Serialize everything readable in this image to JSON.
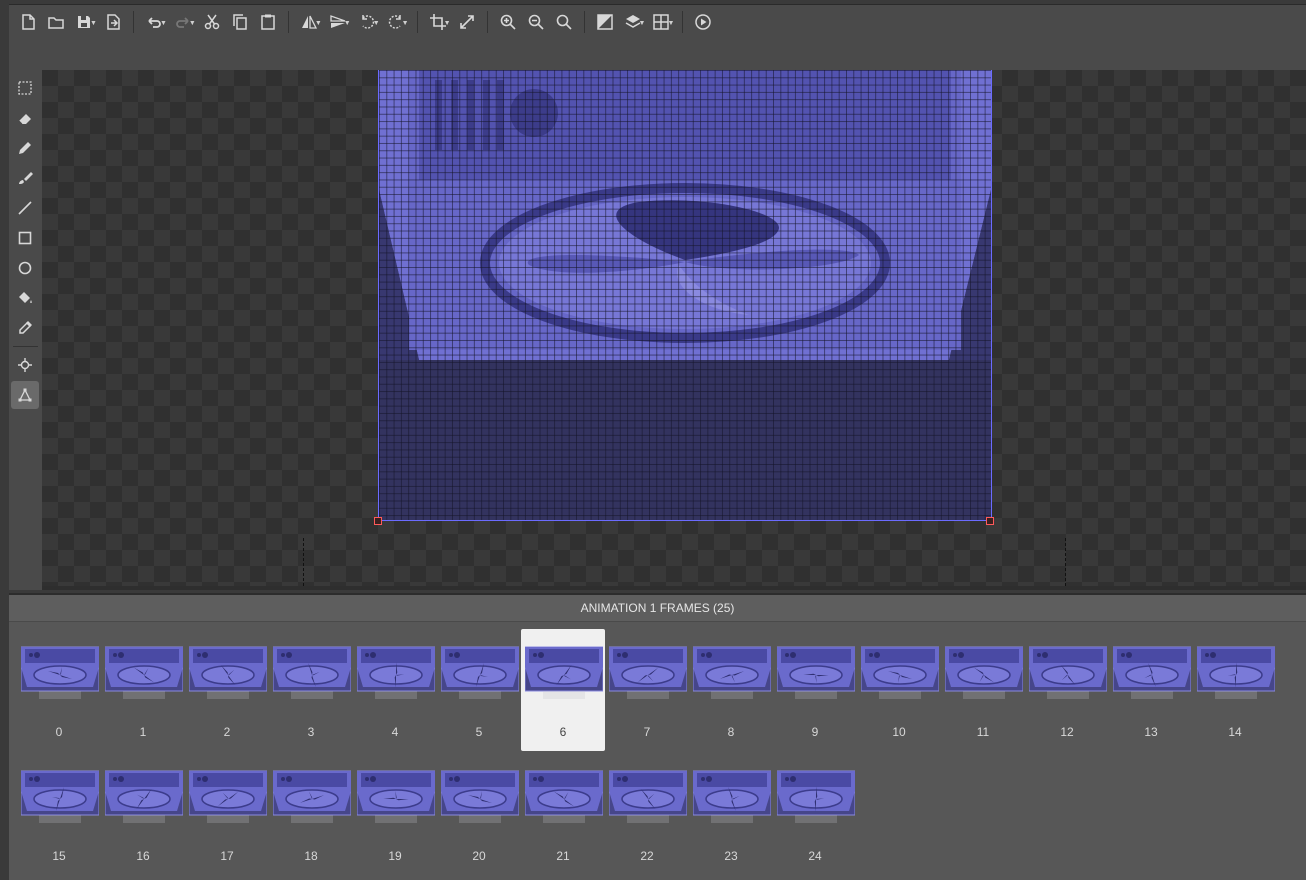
{
  "toolbar": {
    "items": [
      {
        "id": "new-file",
        "icon": "new-file-icon"
      },
      {
        "id": "open-folder",
        "icon": "folder-icon"
      },
      {
        "id": "save",
        "icon": "save-icon",
        "dropdown": true
      },
      {
        "id": "export",
        "icon": "export-icon"
      },
      {
        "id": "undo",
        "icon": "undo-icon",
        "dropdown": true
      },
      {
        "id": "redo",
        "icon": "redo-icon",
        "dropdown": true,
        "disabled": true
      },
      {
        "id": "cut",
        "icon": "scissors-icon"
      },
      {
        "id": "copy",
        "icon": "copy-icon"
      },
      {
        "id": "paste",
        "icon": "paste-icon"
      },
      {
        "id": "flip-horizontal",
        "icon": "flip-horizontal-icon",
        "dropdown": true
      },
      {
        "id": "flip-vertical",
        "icon": "flip-vertical-icon",
        "dropdown": true
      },
      {
        "id": "rotate-left",
        "icon": "rotate-left-icon",
        "dropdown": true
      },
      {
        "id": "rotate-right",
        "icon": "rotate-right-icon",
        "dropdown": true
      },
      {
        "id": "crop",
        "icon": "crop-icon",
        "dropdown": true
      },
      {
        "id": "resize",
        "icon": "resize-icon"
      },
      {
        "id": "zoom-in",
        "icon": "zoom-in-icon"
      },
      {
        "id": "zoom-out",
        "icon": "zoom-out-icon"
      },
      {
        "id": "zoom-fit",
        "icon": "zoom-icon"
      },
      {
        "id": "background",
        "icon": "background-toggle-icon"
      },
      {
        "id": "layers",
        "icon": "layers-icon",
        "dropdown": true
      },
      {
        "id": "grid",
        "icon": "grid-icon",
        "dropdown": true
      },
      {
        "id": "play",
        "icon": "play-icon"
      }
    ]
  },
  "tools": [
    {
      "id": "marquee",
      "icon": "marquee-select-icon"
    },
    {
      "id": "eraser",
      "icon": "eraser-icon"
    },
    {
      "id": "pencil",
      "icon": "pencil-icon"
    },
    {
      "id": "brush",
      "icon": "brush-icon"
    },
    {
      "id": "line",
      "icon": "line-icon"
    },
    {
      "id": "rectangle",
      "icon": "rectangle-icon"
    },
    {
      "id": "ellipse",
      "icon": "ellipse-icon"
    },
    {
      "id": "fill",
      "icon": "paint-bucket-icon"
    },
    {
      "id": "eyedropper",
      "icon": "eyedropper-icon"
    },
    {
      "id": "origin",
      "icon": "crosshair-icon"
    },
    {
      "id": "transform",
      "icon": "transform-nodes-icon",
      "active": true
    }
  ],
  "frames_panel": {
    "title": "ANIMATION 1 FRAMES (25)",
    "selected_index": 6,
    "frames": [
      "0",
      "1",
      "2",
      "3",
      "4",
      "5",
      "6",
      "7",
      "8",
      "9",
      "10",
      "11",
      "12",
      "13",
      "14",
      "15",
      "16",
      "17",
      "18",
      "19",
      "20",
      "21",
      "22",
      "23",
      "24"
    ]
  },
  "colors": {
    "sprite_fill": "#6d6dd0",
    "sprite_dark": "#2e2e58",
    "selection_outline": "#6b6bff",
    "handle": "#ff5a5a"
  }
}
